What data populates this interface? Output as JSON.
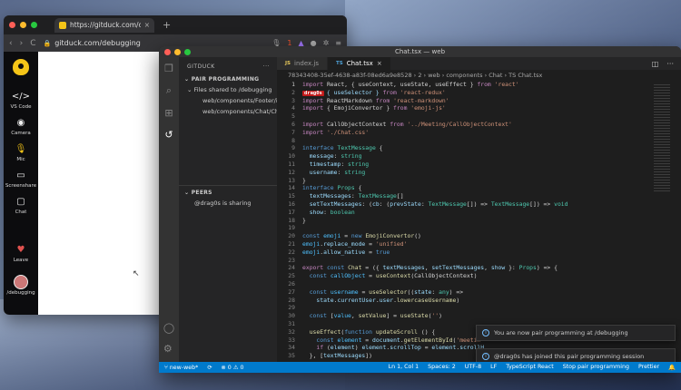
{
  "browser": {
    "tab_title": "https://gitduck.com/debugg",
    "url": "gitduck.com/debugging",
    "new_tab_glyph": "+",
    "nav": {
      "back": "‹",
      "forward": "›",
      "reload": "C"
    },
    "ext_badge": "1"
  },
  "gitduck": {
    "items": [
      {
        "icon": "</>",
        "label": "VS Code"
      },
      {
        "icon": "◉",
        "label": "Camera"
      },
      {
        "icon": "🎙",
        "label": "Mic"
      },
      {
        "icon": "▭",
        "label": "Screenshare"
      },
      {
        "icon": "▢",
        "label": "Chat"
      },
      {
        "icon": "♥",
        "label": "Leave"
      }
    ],
    "user_label": "/debugging"
  },
  "vscode": {
    "window_title": "Chat.tsx — web",
    "sidebar": {
      "title": "GITDUCK",
      "section_pair": "PAIR PROGRAMMING",
      "tree": [
        "Files shared to /debugging",
        "web/components/Footer/i...",
        "web/components/Chat/Ch..."
      ],
      "section_peers": "PEERS",
      "peer_status": "@drag0s is sharing"
    },
    "tabs": [
      {
        "lang": "JS",
        "name": "index.js",
        "active": false
      },
      {
        "lang": "TS",
        "name": "Chat.tsx",
        "active": true
      }
    ],
    "breadcrumb": "78343408-35ef-4638-a83f-08ed6a9e8528 › 2 › web › components › Chat › TS Chat.tsx",
    "cursor_user": "drag0s",
    "code": [
      {
        "n": "1",
        "html": "<span class='kp'>import</span> React, { useContext, useState, useEffect } <span class='kp'>from</span> <span class='st'>'react'</span>"
      },
      {
        "n": "2",
        "html": "<span class='cursor-tag'>drag0s</span><span class='vr'>{ useSelector }</span> <span class='kp'>from</span> <span class='st'>'react-redux'</span>"
      },
      {
        "n": "3",
        "html": "<span class='kp'>import</span> ReactMarkdown <span class='kp'>from</span> <span class='st'>'react-markdown'</span>"
      },
      {
        "n": "4",
        "html": "<span class='kp'>import</span> { EmojiConvertor } <span class='kp'>from</span> <span class='st'>'emoji-js'</span>"
      },
      {
        "n": "5",
        "html": ""
      },
      {
        "n": "6",
        "html": "<span class='kp'>import</span> CallObjectContext <span class='kp'>from</span> <span class='st'>'../Meeting/CallObjectContext'</span>"
      },
      {
        "n": "7",
        "html": "<span class='kp'>import</span> <span class='st'>'./Chat.css'</span>"
      },
      {
        "n": "8",
        "html": ""
      },
      {
        "n": "9",
        "html": "<span class='kw'>interface</span> <span class='ty'>TextMessage</span> {"
      },
      {
        "n": "10",
        "html": "  <span class='vr'>message</span>: <span class='ty'>string</span>"
      },
      {
        "n": "11",
        "html": "  <span class='vr'>timestamp</span>: <span class='ty'>string</span>"
      },
      {
        "n": "12",
        "html": "  <span class='vr'>username</span>: <span class='ty'>string</span>"
      },
      {
        "n": "13",
        "html": "}"
      },
      {
        "n": "14",
        "html": "<span class='kw'>interface</span> <span class='ty'>Props</span> {"
      },
      {
        "n": "15",
        "html": "  <span class='vr'>textMessages</span>: <span class='ty'>TextMessage</span>[]"
      },
      {
        "n": "16",
        "html": "  <span class='vr'>setTextMessages</span>: (<span class='vr'>cb</span>: (<span class='vr'>prevState</span>: <span class='ty'>TextMessage</span>[]) => <span class='ty'>TextMessage</span>[]) => <span class='ty'>void</span>"
      },
      {
        "n": "17",
        "html": "  <span class='vr'>show</span>: <span class='ty'>boolean</span>"
      },
      {
        "n": "18",
        "html": "}"
      },
      {
        "n": "19",
        "html": ""
      },
      {
        "n": "20",
        "html": "<span class='kw'>const</span> <span class='cn'>emoji</span> = <span class='kw'>new</span> <span class='fn'>EmojiConvertor</span>()"
      },
      {
        "n": "21",
        "html": "<span class='cn'>emoji</span>.<span class='vr'>replace_mode</span> = <span class='st'>'unified'</span>"
      },
      {
        "n": "22",
        "html": "<span class='cn'>emoji</span>.<span class='vr'>allow_native</span> = <span class='kw'>true</span>"
      },
      {
        "n": "23",
        "html": ""
      },
      {
        "n": "24",
        "html": "<span class='kp'>export</span> <span class='kw'>const</span> <span class='fn'>Chat</span> = ({ <span class='vr'>textMessages</span>, <span class='vr'>setTextMessages</span>, <span class='vr'>show</span> }: <span class='ty'>Props</span>) => {"
      },
      {
        "n": "25",
        "html": "  <span class='kw'>const</span> <span class='cn'>callObject</span> = <span class='fn'>useContext</span>(CallObjectContext)"
      },
      {
        "n": "26",
        "html": ""
      },
      {
        "n": "27",
        "html": "  <span class='kw'>const</span> <span class='cn'>username</span> = <span class='fn'>useSelector</span>((<span class='vr'>state</span>: <span class='ty'>any</span>) =>"
      },
      {
        "n": "28",
        "html": "    <span class='vr'>state</span>.<span class='vr'>currentUser</span>.<span class='vr'>user</span>.<span class='fn'>lowercaseUsername</span>)"
      },
      {
        "n": "29",
        "html": ""
      },
      {
        "n": "30",
        "html": "  <span class='kw'>const</span> [<span class='cn'>value</span>, <span class='fn'>setValue</span>] = <span class='fn'>useState</span>(<span class='st'>''</span>)"
      },
      {
        "n": "31",
        "html": ""
      },
      {
        "n": "32",
        "html": "  <span class='fn'>useEffect</span>(<span class='kw'>function</span> <span class='fn'>updateScroll</span> () {"
      },
      {
        "n": "33",
        "html": "    <span class='kw'>const</span> <span class='cn'>element</span> = <span class='vr'>document</span>.<span class='fn'>getElementById</span>(<span class='st'>'meetin</span>"
      },
      {
        "n": "34",
        "html": "    <span class='kp'>if</span> (<span class='vr'>element</span>) <span class='vr'>element</span>.<span class='vr'>scrollTop</span> = <span class='vr'>element</span>.<span class='vr'>scrollH</span>"
      },
      {
        "n": "35",
        "html": "  }, [<span class='vr'>textMessages</span>])"
      }
    ],
    "notifications": [
      "You are now pair programming at /debugging",
      "@drag0s has joined this pair programming session"
    ],
    "status": {
      "branch": "new-web*",
      "sync": "⟳",
      "problems": "⊗ 0 ⚠ 0",
      "position": "Ln 1, Col 1",
      "spaces": "Spaces: 2",
      "encoding": "UTF-8",
      "eol": "LF",
      "language": "TypeScript React",
      "pair": "Stop pair programming",
      "prettier": "Prettier"
    }
  }
}
